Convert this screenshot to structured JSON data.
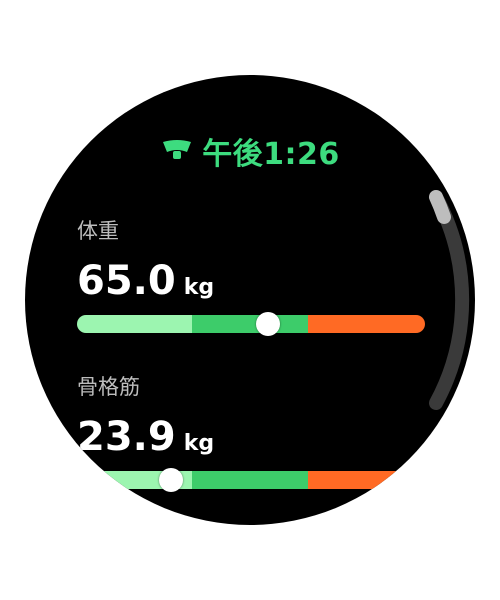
{
  "header": {
    "time": "午後1:26",
    "icon": "scale-icon"
  },
  "colors": {
    "accent": "#3ddc7f",
    "range_low": "#9cf5b0",
    "range_normal": "#3dcc6a",
    "range_high": "#ff6a24",
    "scroll_track": "#3a3a3a",
    "scroll_thumb": "#bdbdbd"
  },
  "metrics": [
    {
      "label": "体重",
      "value": "65.0",
      "unit": "kg",
      "marker_fraction": 0.55
    },
    {
      "label": "骨格筋",
      "value": "23.9",
      "unit": "kg",
      "marker_fraction": 0.27
    }
  ]
}
